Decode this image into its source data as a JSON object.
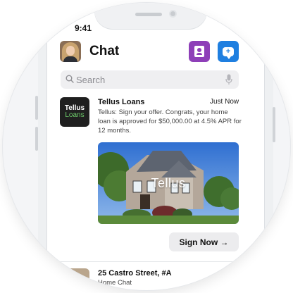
{
  "status_bar": {
    "time": "9:41",
    "right": ""
  },
  "header": {
    "title": "Chat",
    "contacts_icon": "contacts-icon",
    "compose_icon": "compose-message-icon"
  },
  "search": {
    "placeholder": "Search",
    "icon": "search-icon",
    "mic_icon": "microphone-icon"
  },
  "messages": [
    {
      "logo_line1": "Tellus",
      "logo_line2": "Loans",
      "sender": "Tellus Loans",
      "time": "Just Now",
      "preview": "Tellus: Sign your offer. Congrats, your home loan is approved for $50,000.00 at 4.5% APR for 12 months.",
      "image_brand": "Tellus",
      "cta_label": "Sign Now →"
    },
    {
      "sender": "25 Castro Street, #A",
      "time": "",
      "preview": "Home Chat"
    }
  ],
  "colors": {
    "contacts": "#8e3fb8",
    "compose": "#1f7fe0",
    "logo_green": "#6fcf6c"
  }
}
